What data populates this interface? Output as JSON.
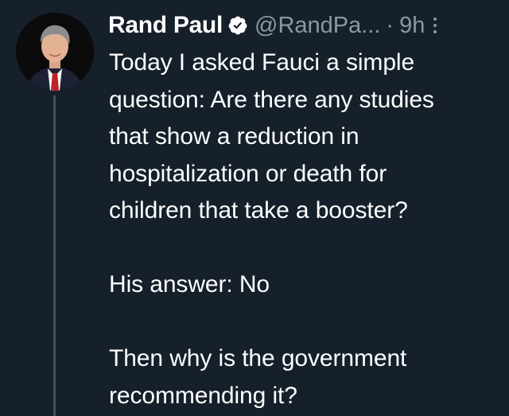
{
  "tweet": {
    "author": {
      "display_name": "Rand Paul",
      "handle": "@RandPa...",
      "verified_icon": "verified-badge-icon",
      "avatar": "profile-photo"
    },
    "separator": "·",
    "timestamp": "9h",
    "more_icon": "more-vertical-icon",
    "paragraphs": [
      {
        "lines": [
          "Today I asked Fauci a simple",
          "question: Are there any studies",
          "that show a reduction in",
          "hospitalization or death for",
          "children that take a booster?"
        ]
      },
      {
        "lines": [
          "His answer: No"
        ]
      },
      {
        "lines": [
          "Then why is the government",
          "recommending it?"
        ]
      }
    ]
  },
  "colors": {
    "background": "#15202b",
    "text_primary": "#ffffff",
    "text_secondary": "#8899a6",
    "verified": "#ffffff",
    "thread_line": "#3d5466"
  }
}
